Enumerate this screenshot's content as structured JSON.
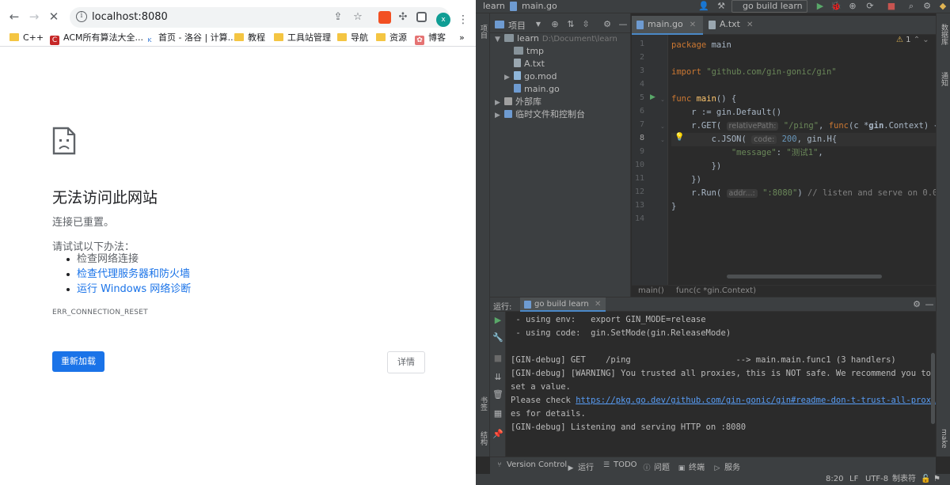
{
  "browser": {
    "url": "localhost:8080",
    "avatar_letter": "x",
    "bookmarks": [
      {
        "label": "C++",
        "type": "folder"
      },
      {
        "label": "ACM所有算法大全...",
        "type": "site"
      },
      {
        "label": "首页 - 洛谷 | 计算...",
        "type": "site"
      },
      {
        "label": "教程",
        "type": "folder"
      },
      {
        "label": "工具站管理",
        "type": "folder"
      },
      {
        "label": "导航",
        "type": "folder"
      },
      {
        "label": "资源",
        "type": "folder"
      },
      {
        "label": "博客",
        "type": "site"
      }
    ],
    "bookmarks_overflow": "»",
    "error": {
      "title": "无法访问此网站",
      "subtitle": "连接已重置。",
      "try_label": "请试试以下办法：",
      "suggestions": [
        "检查网络连接",
        "检查代理服务器和防火墙",
        "运行 Windows 网络诊断"
      ],
      "code": "ERR_CONNECTION_RESET",
      "reload_label": "重新加载",
      "details_label": "详情"
    }
  },
  "ide": {
    "breadcrumb_project": "learn",
    "breadcrumb_file": "main.go",
    "run_config": "go build learn",
    "left_stripe": [
      "项目",
      "书签",
      "结构"
    ],
    "right_stripe": [
      "数据库",
      "通知",
      "make"
    ],
    "project_pane": {
      "label": "项目",
      "tree": [
        {
          "name": "learn",
          "path": "D:\\Document\\learn",
          "level": 0,
          "expanded": true,
          "kind": "folder"
        },
        {
          "name": "tmp",
          "level": 1,
          "kind": "folder"
        },
        {
          "name": "A.txt",
          "level": 1,
          "kind": "file"
        },
        {
          "name": "go.mod",
          "level": 1,
          "kind": "mod",
          "collapsed": true
        },
        {
          "name": "main.go",
          "level": 1,
          "kind": "go"
        },
        {
          "name": "外部库",
          "level": 0,
          "kind": "lib",
          "collapsed": true
        },
        {
          "name": "临时文件和控制台",
          "level": 0,
          "kind": "scratch",
          "collapsed": true
        }
      ]
    },
    "editor": {
      "tabs": [
        {
          "name": "main.go",
          "active": true
        },
        {
          "name": "A.txt",
          "active": false
        }
      ],
      "warnings": "1",
      "current_line": 8,
      "line_numbers": [
        "1",
        "2",
        "3",
        "4",
        "5",
        "6",
        "7",
        "8",
        "9",
        "10",
        "11",
        "12",
        "13",
        "14"
      ],
      "code_lines": [
        "package main",
        "",
        "import \"github.com/gin-gonic/gin\"",
        "",
        "func main() {",
        "    r := gin.Default()",
        "    r.GET( relativePath: \"/ping\", func(c *gin.Context) {",
        "        c.JSON( code: 200, gin.H{",
        "            \"message\": \"测试1\",",
        "        })",
        "    })",
        "    r.Run( addr...: \":8080\") // listen and serve on 0.0.0.0:8080",
        "}",
        ""
      ],
      "breadcrumb": [
        "main()",
        "func(c *gin.Context)"
      ]
    },
    "run_panel": {
      "label": "运行:",
      "tab": "go build learn",
      "console": [
        " - using env:   export GIN_MODE=release",
        " - using code:  gin.SetMode(gin.ReleaseMode)",
        "",
        "[GIN-debug] GET    /ping                     --> main.main.func1 (3 handlers)",
        "[GIN-debug] [WARNING] You trusted all proxies, this is NOT safe. We recommend you to",
        "set a value.",
        "Please check https://pkg.go.dev/github.com/gin-gonic/gin#readme-don-t-trust-all-proxi",
        "es for details.",
        "[GIN-debug] Listening and serving HTTP on :8080"
      ],
      "console_link": "https://pkg.go.dev/github.com/gin-gonic/gin#readme-don-t-trust-all-proxi"
    },
    "tool_windows": [
      "Version Control",
      "运行",
      "TODO",
      "问题",
      "终端",
      "服务"
    ],
    "status": {
      "position": "8:20",
      "line_sep": "LF",
      "encoding": "UTF-8",
      "indent": "制表符"
    }
  },
  "colors": {
    "chrome_accent": "#1a73e8",
    "ide_bg": "#2b2b2b",
    "ide_panel": "#3c3f41",
    "keyword": "#cc7832",
    "string": "#6a8759",
    "number": "#6897bb",
    "function": "#ffc66d"
  }
}
